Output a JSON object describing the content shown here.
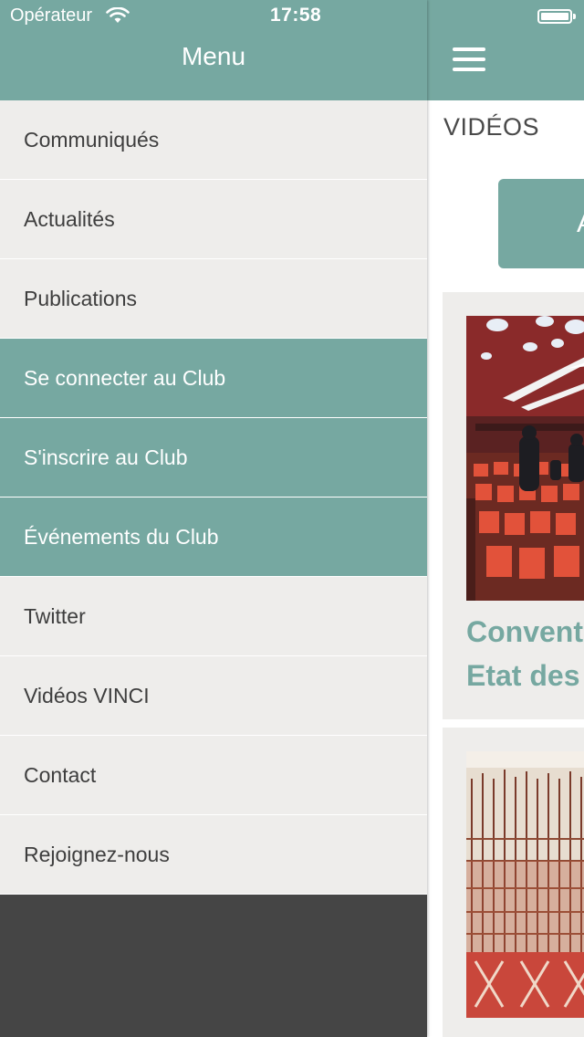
{
  "status_bar": {
    "carrier": "Opérateur",
    "time": "17:58",
    "battery_level": 1.0
  },
  "drawer": {
    "title": "Menu",
    "items": [
      {
        "label": "Communiqués",
        "highlighted": false
      },
      {
        "label": "Actualités",
        "highlighted": false
      },
      {
        "label": "Publications",
        "highlighted": false
      },
      {
        "label": "Se connecter au Club",
        "highlighted": true
      },
      {
        "label": "S'inscrire au Club",
        "highlighted": true
      },
      {
        "label": "Événements du Club",
        "highlighted": true
      },
      {
        "label": "Twitter",
        "highlighted": false
      },
      {
        "label": "Vidéos VINCI",
        "highlighted": false
      },
      {
        "label": "Contact",
        "highlighted": false
      },
      {
        "label": "Rejoignez-nous",
        "highlighted": false
      }
    ]
  },
  "content": {
    "section_title": "VIDÉOS",
    "action_button_label": "A",
    "videos": [
      {
        "title_line1": "Conventi",
        "title_line2": "Etat des"
      }
    ]
  },
  "colors": {
    "accent": "#76a8a1",
    "menu_bg": "#eeedeb",
    "drawer_bottom": "#454545",
    "menu_text": "#3e3e3e"
  },
  "icons": {
    "menu_toggle": "hamburger-icon",
    "wifi": "wifi-icon",
    "battery": "battery-icon"
  }
}
